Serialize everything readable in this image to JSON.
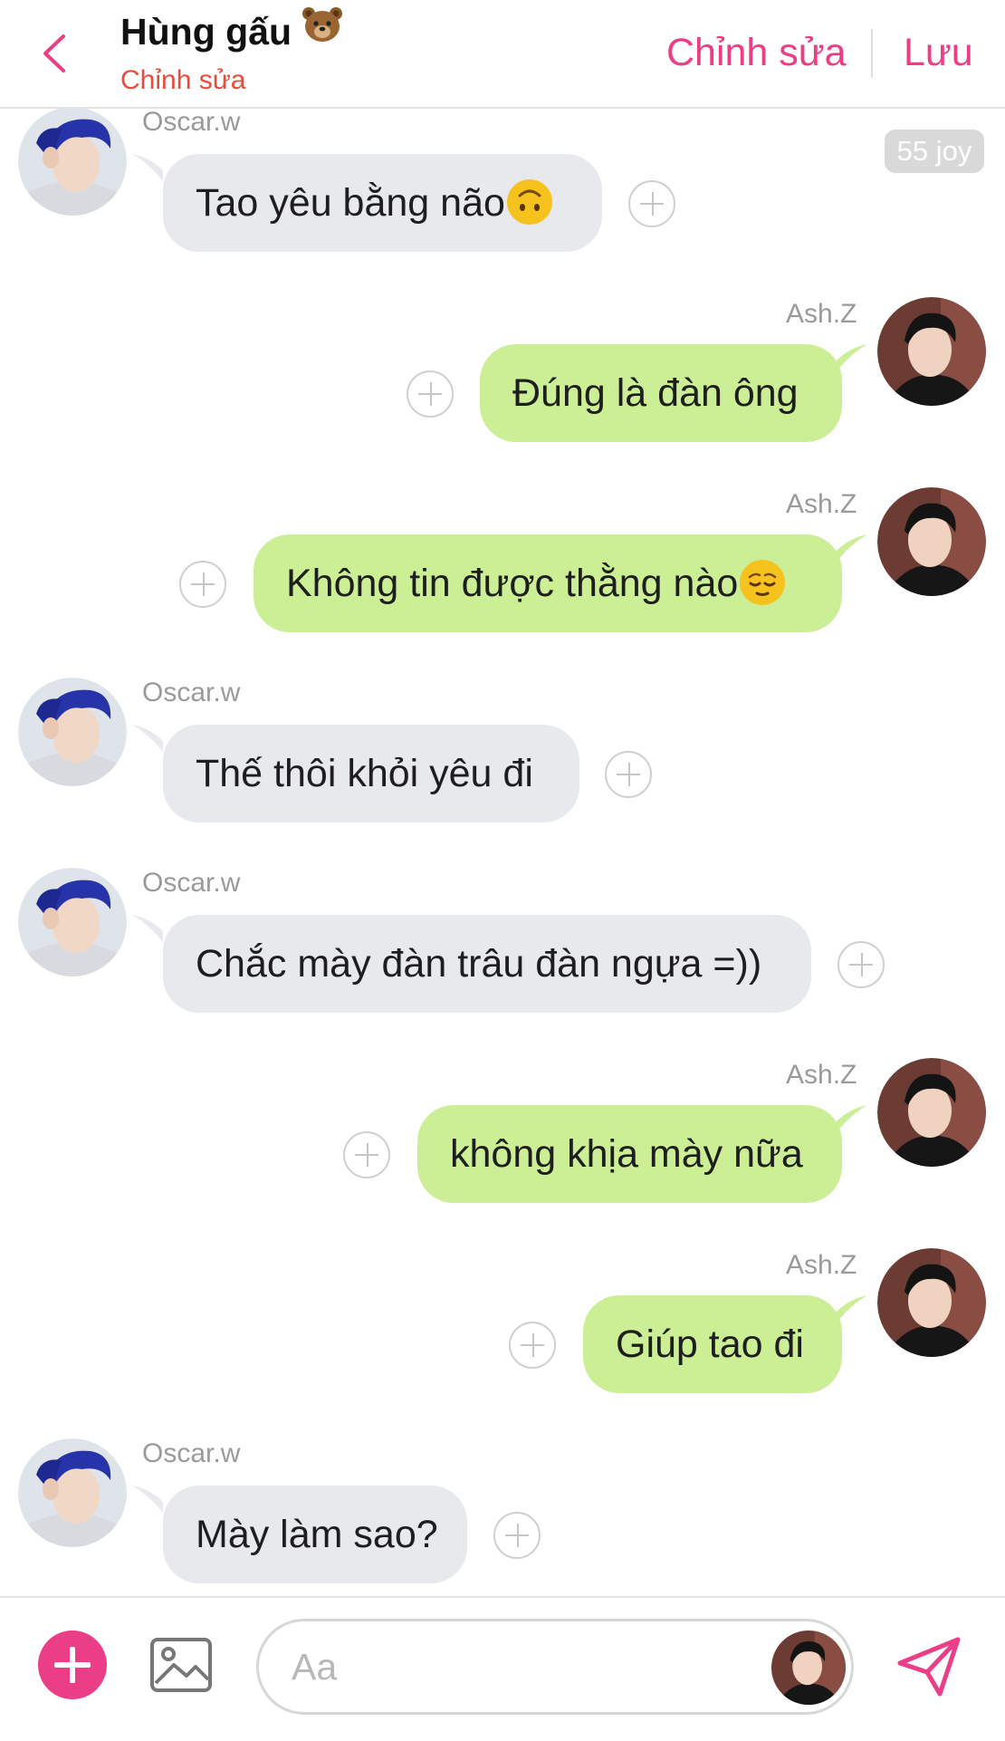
{
  "header": {
    "title": "Hùng gấu",
    "title_emoji": "bear-face-emoji",
    "subtitle": "Chỉnh sửa",
    "edit_label": "Chỉnh sửa",
    "save_label": "Lưu"
  },
  "badge": {
    "text": "55 joy"
  },
  "colors": {
    "accent": "#ec3d87",
    "subtitle": "#e84c3d",
    "incoming_bubble": "#e7e9ec",
    "outgoing_bubble": "#ccef95"
  },
  "messages": [
    {
      "sender": "Oscar.w",
      "text": "Tao yêu bằng não",
      "emoji": "upside-down-face-emoji",
      "direction": "incoming"
    },
    {
      "sender": "Ash.Z",
      "text": "Đúng là đàn ông",
      "direction": "outgoing"
    },
    {
      "sender": "Ash.Z",
      "text": "Không tin được thằng nào",
      "emoji": "relieved-face-emoji",
      "direction": "outgoing"
    },
    {
      "sender": "Oscar.w",
      "text": "Thế thôi khỏi yêu đi",
      "direction": "incoming"
    },
    {
      "sender": "Oscar.w",
      "text": "Chắc mày đàn trâu đàn ngựa =))",
      "direction": "incoming"
    },
    {
      "sender": "Ash.Z",
      "text": "không khịa mày nữa",
      "direction": "outgoing"
    },
    {
      "sender": "Ash.Z",
      "text": "Giúp tao đi",
      "direction": "outgoing"
    },
    {
      "sender": "Oscar.w",
      "text": "Mày làm sao?",
      "direction": "incoming"
    }
  ],
  "composer": {
    "placeholder": "Aa"
  }
}
